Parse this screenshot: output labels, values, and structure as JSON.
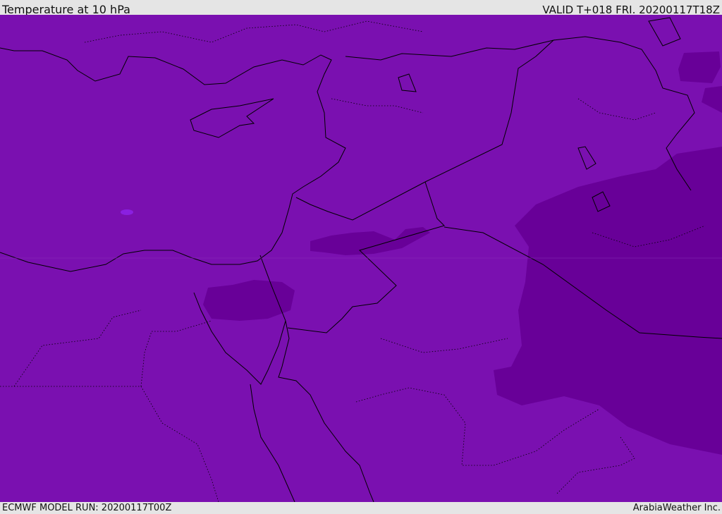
{
  "header": {
    "title": "Temperature at 10 hPa",
    "valid": "VALID T+018 FRI. 20200117T18Z"
  },
  "footer": {
    "model_run": "ECMWF MODEL RUN: 20200117T00Z",
    "credit": "ArabiaWeather Inc."
  },
  "colors": {
    "base_field": "#7a10b0",
    "cold_field": "#680098",
    "coast": "#000000",
    "label_bg": "#e5e5e5"
  }
}
